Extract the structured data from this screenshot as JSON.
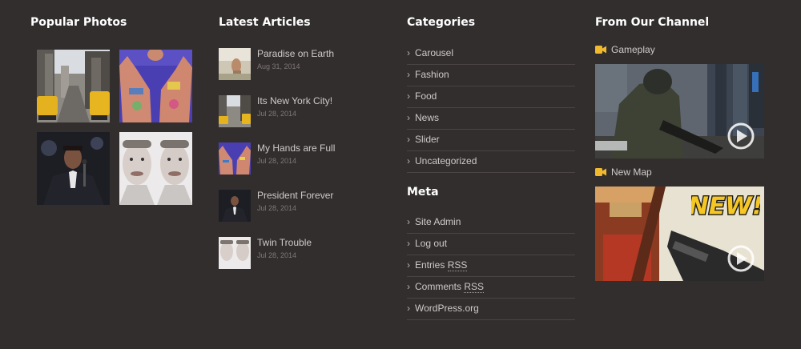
{
  "popular_photos": {
    "title": "Popular Photos"
  },
  "latest_articles": {
    "title": "Latest Articles",
    "items": [
      {
        "title": "Paradise on Earth",
        "date": "Aug 31, 2014"
      },
      {
        "title": "Its New York City!",
        "date": "Jul 28, 2014"
      },
      {
        "title": "My Hands are Full",
        "date": "Jul 28, 2014"
      },
      {
        "title": "President Forever",
        "date": "Jul 28, 2014"
      },
      {
        "title": "Twin Trouble",
        "date": "Jul 28, 2014"
      }
    ]
  },
  "categories": {
    "title": "Categories",
    "items": [
      "Carousel",
      "Fashion",
      "Food",
      "News",
      "Slider",
      "Uncategorized"
    ]
  },
  "meta": {
    "title": "Meta",
    "items": {
      "site_admin": "Site Admin",
      "log_out": "Log out",
      "entries": "Entries",
      "comments": "Comments",
      "rss": "RSS",
      "wordpress": "WordPress.org"
    }
  },
  "channel": {
    "title": "From Our Channel",
    "videos": [
      {
        "title": "Gameplay"
      },
      {
        "title": "New Map",
        "badge": "NEW!"
      }
    ]
  },
  "colors": {
    "background": "#332e2e",
    "accent": "#f0b92e",
    "divider": "#4a4444"
  }
}
